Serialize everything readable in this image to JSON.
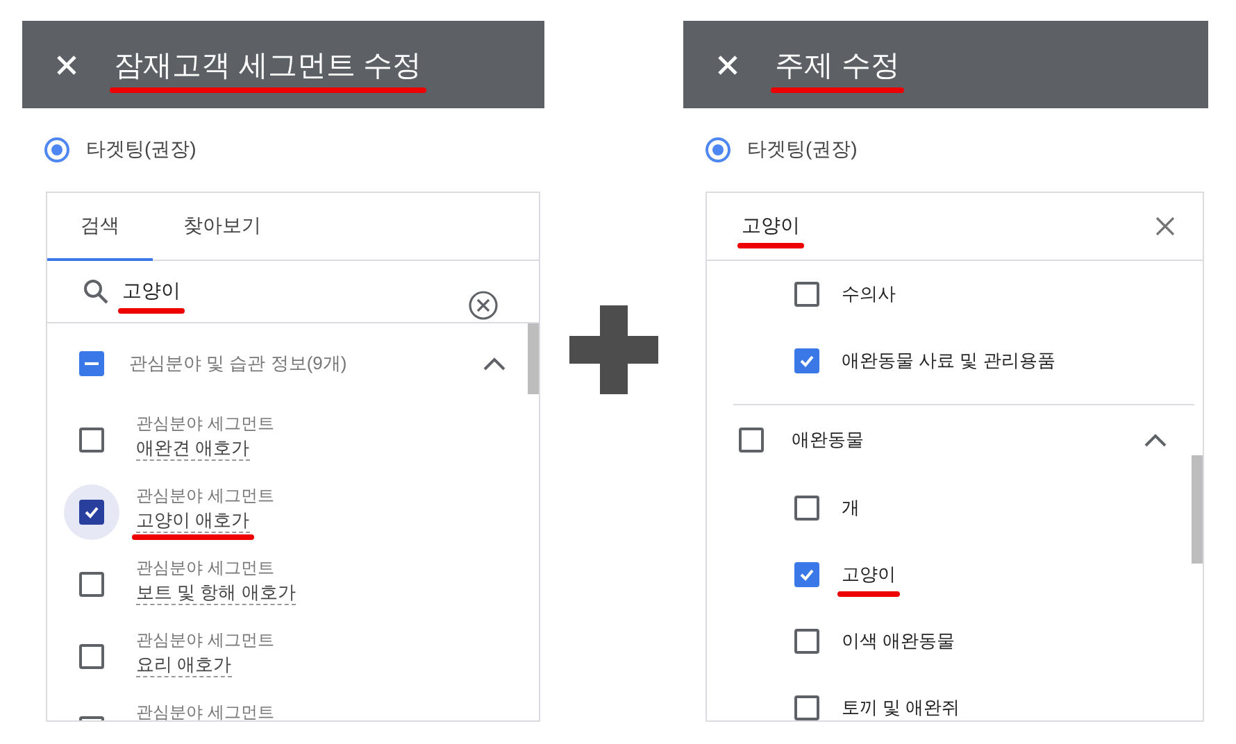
{
  "left_panel": {
    "title": "잠재고객 세그먼트 수정",
    "title_underlined": true,
    "radio": {
      "label": "타겟팅(권장)",
      "selected": true
    },
    "tabs": [
      {
        "label": "검색",
        "selected": true
      },
      {
        "label": "찾아보기",
        "selected": false
      }
    ],
    "search": {
      "value": "고양이",
      "underlined": true
    },
    "group": {
      "label": "관심분야 및 습관 정보(9개)",
      "indeterminate": true,
      "expanded": true
    },
    "items": [
      {
        "category": "관심분야 세그먼트",
        "label": "애완견 애호가",
        "checked": false,
        "underlined": false
      },
      {
        "category": "관심분야 세그먼트",
        "label": "고양이 애호가",
        "checked": true,
        "underlined": true
      },
      {
        "category": "관심분야 세그먼트",
        "label": "보트 및 항해 애호가",
        "checked": false,
        "underlined": false
      },
      {
        "category": "관심분야 세그먼트",
        "label": "요리 애호가",
        "checked": false,
        "underlined": false
      },
      {
        "category": "관심분야 세그먼트",
        "checked": false
      }
    ]
  },
  "right_panel": {
    "title": "주제 수정",
    "title_underlined": true,
    "radio": {
      "label": "타겟팅(권장)",
      "selected": true
    },
    "search": {
      "value": "고양이",
      "underlined": true
    },
    "items": [
      {
        "kind": "child",
        "label": "수의사",
        "checked": false,
        "underlined": false
      },
      {
        "kind": "child",
        "label": "애완동물 사료 및 관리용품",
        "checked": true,
        "underlined": false
      },
      {
        "kind": "divider"
      },
      {
        "kind": "group",
        "label": "애완동물",
        "checked": false,
        "expanded": true
      },
      {
        "kind": "child",
        "label": "개",
        "checked": false,
        "underlined": false
      },
      {
        "kind": "child",
        "label": "고양이",
        "checked": true,
        "underlined": true
      },
      {
        "kind": "child",
        "label": "이색 애완동물",
        "checked": false,
        "underlined": false
      },
      {
        "kind": "child",
        "label": "토끼 및 애완쥐",
        "checked": false,
        "underlined": false
      }
    ]
  }
}
